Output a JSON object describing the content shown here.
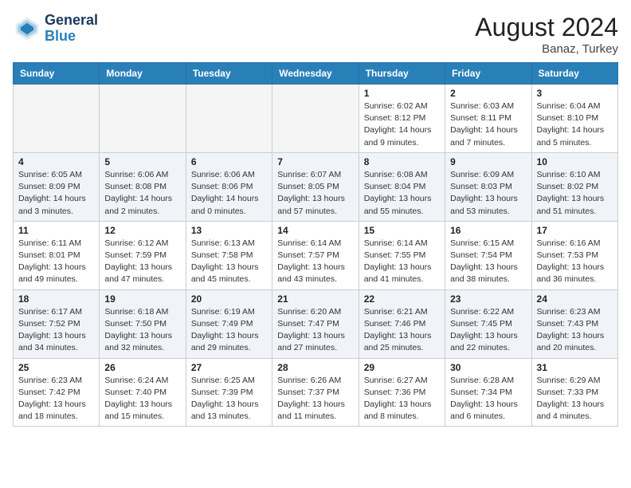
{
  "header": {
    "logo_line1": "General",
    "logo_line2": "Blue",
    "month_year": "August 2024",
    "location": "Banaz, Turkey"
  },
  "days_of_week": [
    "Sunday",
    "Monday",
    "Tuesday",
    "Wednesday",
    "Thursday",
    "Friday",
    "Saturday"
  ],
  "weeks": [
    [
      {
        "day": "",
        "info": ""
      },
      {
        "day": "",
        "info": ""
      },
      {
        "day": "",
        "info": ""
      },
      {
        "day": "",
        "info": ""
      },
      {
        "day": "1",
        "info": "Sunrise: 6:02 AM\nSunset: 8:12 PM\nDaylight: 14 hours\nand 9 minutes."
      },
      {
        "day": "2",
        "info": "Sunrise: 6:03 AM\nSunset: 8:11 PM\nDaylight: 14 hours\nand 7 minutes."
      },
      {
        "day": "3",
        "info": "Sunrise: 6:04 AM\nSunset: 8:10 PM\nDaylight: 14 hours\nand 5 minutes."
      }
    ],
    [
      {
        "day": "4",
        "info": "Sunrise: 6:05 AM\nSunset: 8:09 PM\nDaylight: 14 hours\nand 3 minutes."
      },
      {
        "day": "5",
        "info": "Sunrise: 6:06 AM\nSunset: 8:08 PM\nDaylight: 14 hours\nand 2 minutes."
      },
      {
        "day": "6",
        "info": "Sunrise: 6:06 AM\nSunset: 8:06 PM\nDaylight: 14 hours\nand 0 minutes."
      },
      {
        "day": "7",
        "info": "Sunrise: 6:07 AM\nSunset: 8:05 PM\nDaylight: 13 hours\nand 57 minutes."
      },
      {
        "day": "8",
        "info": "Sunrise: 6:08 AM\nSunset: 8:04 PM\nDaylight: 13 hours\nand 55 minutes."
      },
      {
        "day": "9",
        "info": "Sunrise: 6:09 AM\nSunset: 8:03 PM\nDaylight: 13 hours\nand 53 minutes."
      },
      {
        "day": "10",
        "info": "Sunrise: 6:10 AM\nSunset: 8:02 PM\nDaylight: 13 hours\nand 51 minutes."
      }
    ],
    [
      {
        "day": "11",
        "info": "Sunrise: 6:11 AM\nSunset: 8:01 PM\nDaylight: 13 hours\nand 49 minutes."
      },
      {
        "day": "12",
        "info": "Sunrise: 6:12 AM\nSunset: 7:59 PM\nDaylight: 13 hours\nand 47 minutes."
      },
      {
        "day": "13",
        "info": "Sunrise: 6:13 AM\nSunset: 7:58 PM\nDaylight: 13 hours\nand 45 minutes."
      },
      {
        "day": "14",
        "info": "Sunrise: 6:14 AM\nSunset: 7:57 PM\nDaylight: 13 hours\nand 43 minutes."
      },
      {
        "day": "15",
        "info": "Sunrise: 6:14 AM\nSunset: 7:55 PM\nDaylight: 13 hours\nand 41 minutes."
      },
      {
        "day": "16",
        "info": "Sunrise: 6:15 AM\nSunset: 7:54 PM\nDaylight: 13 hours\nand 38 minutes."
      },
      {
        "day": "17",
        "info": "Sunrise: 6:16 AM\nSunset: 7:53 PM\nDaylight: 13 hours\nand 36 minutes."
      }
    ],
    [
      {
        "day": "18",
        "info": "Sunrise: 6:17 AM\nSunset: 7:52 PM\nDaylight: 13 hours\nand 34 minutes."
      },
      {
        "day": "19",
        "info": "Sunrise: 6:18 AM\nSunset: 7:50 PM\nDaylight: 13 hours\nand 32 minutes."
      },
      {
        "day": "20",
        "info": "Sunrise: 6:19 AM\nSunset: 7:49 PM\nDaylight: 13 hours\nand 29 minutes."
      },
      {
        "day": "21",
        "info": "Sunrise: 6:20 AM\nSunset: 7:47 PM\nDaylight: 13 hours\nand 27 minutes."
      },
      {
        "day": "22",
        "info": "Sunrise: 6:21 AM\nSunset: 7:46 PM\nDaylight: 13 hours\nand 25 minutes."
      },
      {
        "day": "23",
        "info": "Sunrise: 6:22 AM\nSunset: 7:45 PM\nDaylight: 13 hours\nand 22 minutes."
      },
      {
        "day": "24",
        "info": "Sunrise: 6:23 AM\nSunset: 7:43 PM\nDaylight: 13 hours\nand 20 minutes."
      }
    ],
    [
      {
        "day": "25",
        "info": "Sunrise: 6:23 AM\nSunset: 7:42 PM\nDaylight: 13 hours\nand 18 minutes."
      },
      {
        "day": "26",
        "info": "Sunrise: 6:24 AM\nSunset: 7:40 PM\nDaylight: 13 hours\nand 15 minutes."
      },
      {
        "day": "27",
        "info": "Sunrise: 6:25 AM\nSunset: 7:39 PM\nDaylight: 13 hours\nand 13 minutes."
      },
      {
        "day": "28",
        "info": "Sunrise: 6:26 AM\nSunset: 7:37 PM\nDaylight: 13 hours\nand 11 minutes."
      },
      {
        "day": "29",
        "info": "Sunrise: 6:27 AM\nSunset: 7:36 PM\nDaylight: 13 hours\nand 8 minutes."
      },
      {
        "day": "30",
        "info": "Sunrise: 6:28 AM\nSunset: 7:34 PM\nDaylight: 13 hours\nand 6 minutes."
      },
      {
        "day": "31",
        "info": "Sunrise: 6:29 AM\nSunset: 7:33 PM\nDaylight: 13 hours\nand 4 minutes."
      }
    ]
  ]
}
